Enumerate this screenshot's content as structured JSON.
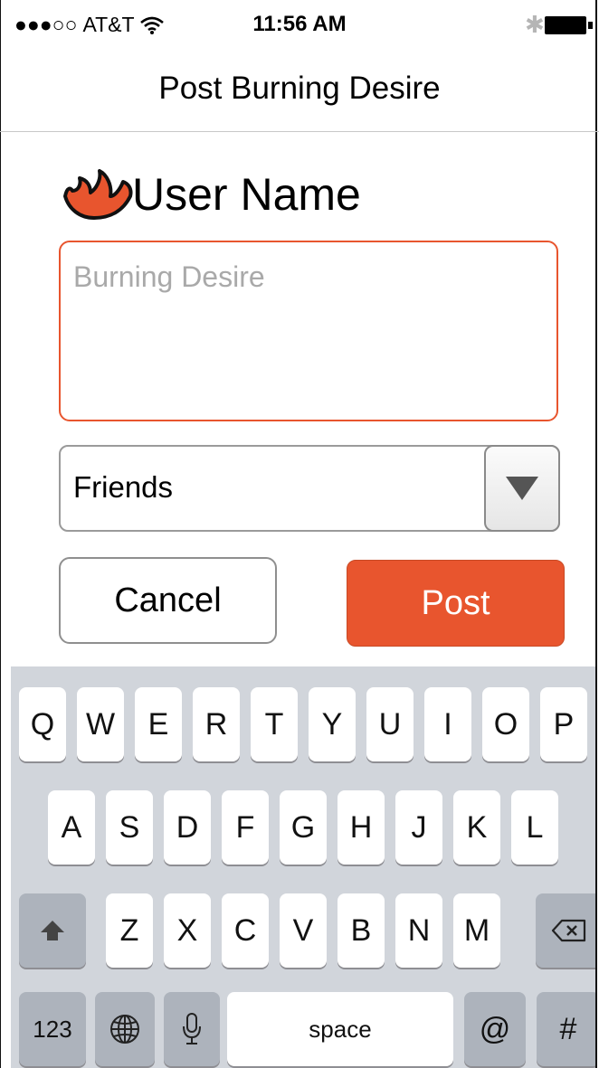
{
  "status_bar": {
    "carrier": "AT&T",
    "time": "11:56 AM"
  },
  "nav": {
    "title": "Post Burning Desire"
  },
  "user": {
    "name": "User Name"
  },
  "composer": {
    "placeholder": "Burning Desire"
  },
  "audience": {
    "selected": "Friends"
  },
  "actions": {
    "cancel_label": "Cancel",
    "post_label": "Post"
  },
  "keyboard": {
    "row1": [
      "Q",
      "W",
      "E",
      "R",
      "T",
      "Y",
      "U",
      "I",
      "O",
      "P"
    ],
    "row2": [
      "A",
      "S",
      "D",
      "F",
      "G",
      "H",
      "J",
      "K",
      "L"
    ],
    "row3": [
      "Z",
      "X",
      "C",
      "V",
      "B",
      "N",
      "M"
    ],
    "numbers_label": "123",
    "space_label": "space",
    "at_label": "@",
    "hash_label": "#"
  },
  "colors": {
    "accent": "#e8552e",
    "keyboard_bg": "#d1d5db"
  }
}
